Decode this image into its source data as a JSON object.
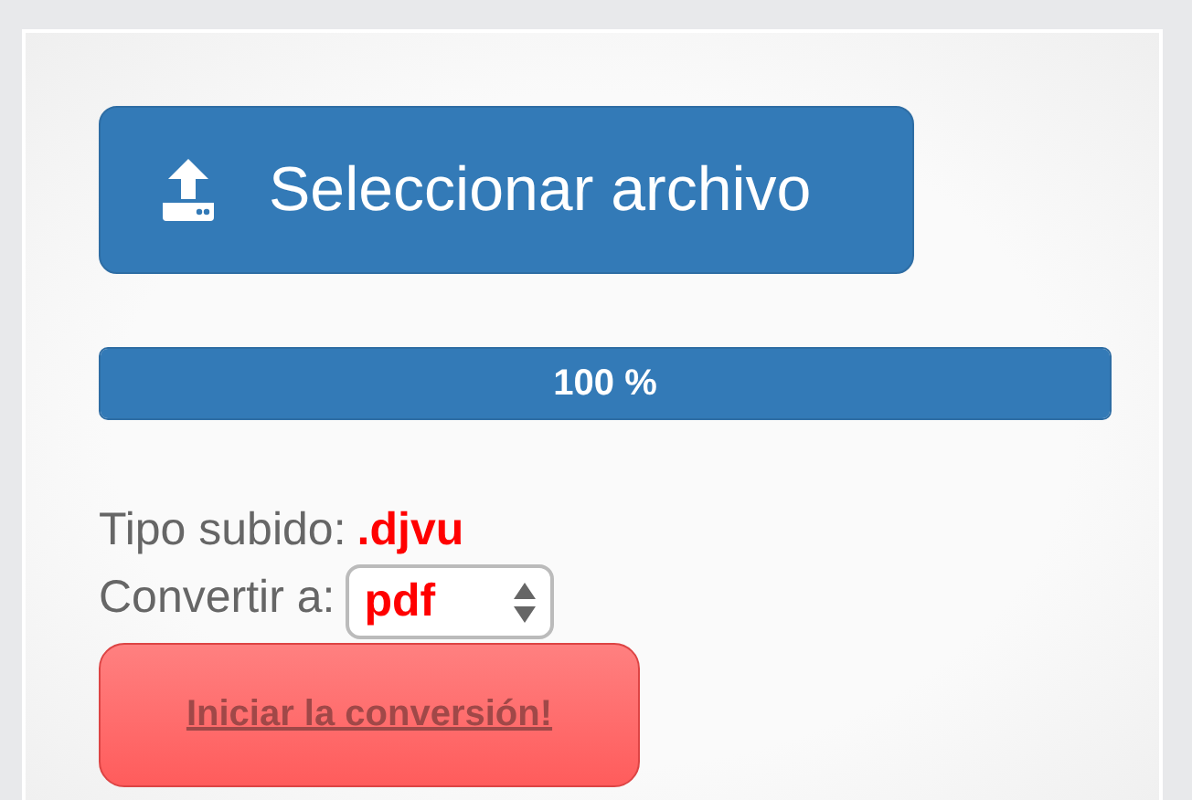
{
  "upload_button": {
    "label": "Seleccionar archivo"
  },
  "progress": {
    "level": 1.0,
    "label": "100 %"
  },
  "uploaded_type": {
    "label": "Tipo subido:",
    "value": ".djvu"
  },
  "convert_to": {
    "label": "Convertir a:",
    "value": "pdf"
  },
  "start_button": {
    "label": "Iniciar la conversión!"
  }
}
